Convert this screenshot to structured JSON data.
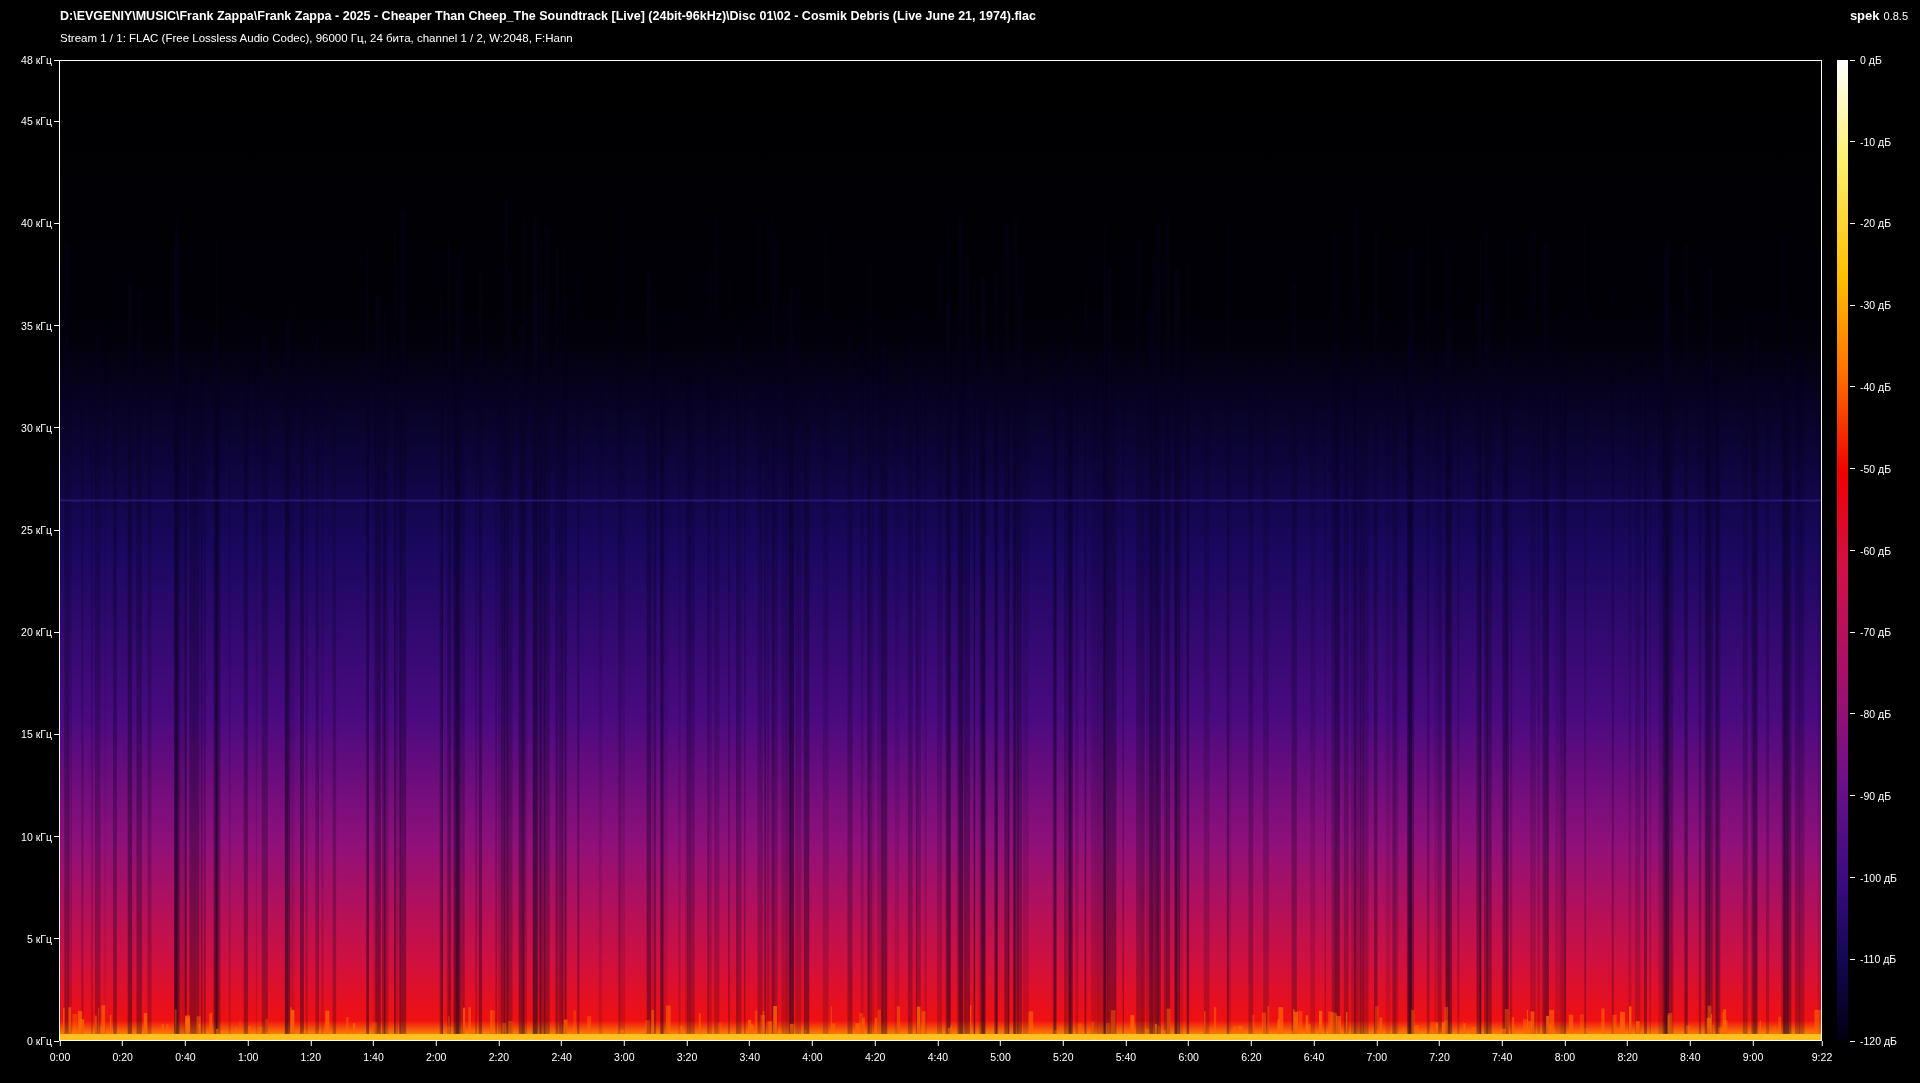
{
  "window": {
    "title": "D:\\EVGENIY\\MUSIC\\Frank Zappa\\Frank Zappa - 2025 - Cheaper Than Cheep_The Soundtrack [Live] (24bit-96kHz)\\Disc 01\\02 - Cosmik Debris (Live June 21, 1974).flac",
    "app_name": "spek",
    "app_version": "0.8.5"
  },
  "stream_info": "Stream 1 / 1: FLAC (Free Lossless Audio Codec), 96000 Гц, 24 бита, channel 1 / 2, W:2048, F:Hann",
  "frequency_axis": {
    "ticks": [
      "48 кГц",
      "45 кГц",
      "40 кГц",
      "35 кГц",
      "30 кГц",
      "25 кГц",
      "20 кГц",
      "15 кГц",
      "10 кГц",
      "5 кГц",
      "0 кГц"
    ]
  },
  "time_axis": {
    "ticks": [
      "0:00",
      "0:20",
      "0:40",
      "1:00",
      "1:20",
      "1:40",
      "2:00",
      "2:20",
      "2:40",
      "3:00",
      "3:20",
      "3:40",
      "4:00",
      "4:20",
      "4:40",
      "5:00",
      "5:20",
      "5:40",
      "6:00",
      "6:20",
      "6:40",
      "7:00",
      "7:20",
      "7:40",
      "8:00",
      "8:20",
      "8:40",
      "9:00",
      "9:22"
    ]
  },
  "level_scale": {
    "ticks": [
      "0 дБ",
      "-10 дБ",
      "-20 дБ",
      "-30 дБ",
      "-40 дБ",
      "-50 дБ",
      "-60 дБ",
      "-70 дБ",
      "-80 дБ",
      "-90 дБ",
      "-100 дБ",
      "-110 дБ",
      "-120 дБ"
    ]
  }
}
